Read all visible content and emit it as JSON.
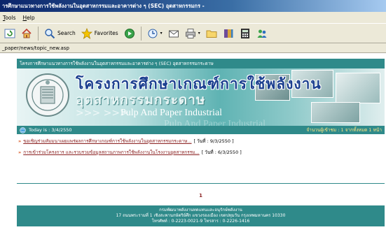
{
  "window": {
    "title": "ารศึกษาแนวทางการใช้พลังงานในอุตสาหกรรมและอาคารต่าง ๆ (SEC) อุตสาหกรรมกร -"
  },
  "menu": {
    "items": [
      "Tools",
      "Help"
    ]
  },
  "toolbar": {
    "search_label": "Search",
    "favorites_label": "Favorites"
  },
  "address": {
    "value": "_paper/news/topic_new.asp"
  },
  "site": {
    "topbar_text": "โครงการศึกษาแนวทางการใช้พลังงานในอุตสาหกรรมและอาคารต่าง ๆ (SEC) อุตสาหกรรมกระดาษ",
    "banner": {
      "title_th": "โครงการศึกษาเกณฑ์การใช้พลังงาน",
      "subtitle_th": "อุตสาหกรรมกระดาษ",
      "title_en": "Pulp And Paper Industrial",
      "title_en_ghost": "Pulp And Paper Industrial",
      "chevrons": ">>> >>>"
    },
    "status": {
      "today_label": "Today is : 3/4/2550",
      "right_text": "จำนวนผู้เข้าชม : 1 จากทั้งหมด 1 หน้า"
    },
    "news": [
      {
        "title": "ขอเชิญร่วมสัมมนาเผยแพร่ผลการศึกษาเกณฑ์การใช้พลังงานในอุตสาหกรรมกระดาษ...",
        "date": "[ วันที่ : 9/3/2550 ]"
      },
      {
        "title": "การเข้าร่วมโครงการ และรวบรวมข้อมูลสถานภาพการใช้พลังงานในโรงงานอุตสาหกรรม...",
        "date": "[ วันที่ : 6/3/2550 ]"
      }
    ],
    "pager": "1",
    "footer": {
      "line1": "กรมพัฒนาพลังงานทดแทนและอนุรักษ์พลังงาน",
      "line2": "17 ถนนพระรามที่ 1 เชิงสะพานกษัตริย์ศึก แขวงรองเมือง เขตปทุมวัน กรุงเทพมหานคร 10330",
      "line3": "โทรศัพท์ : 0-2223-0021-9 โทรสาร : 0-2226-1416"
    }
  },
  "colors": {
    "site_teal": "#2f8a8a",
    "news_title": "#8a1f1f",
    "arrow": "#d9541e"
  }
}
